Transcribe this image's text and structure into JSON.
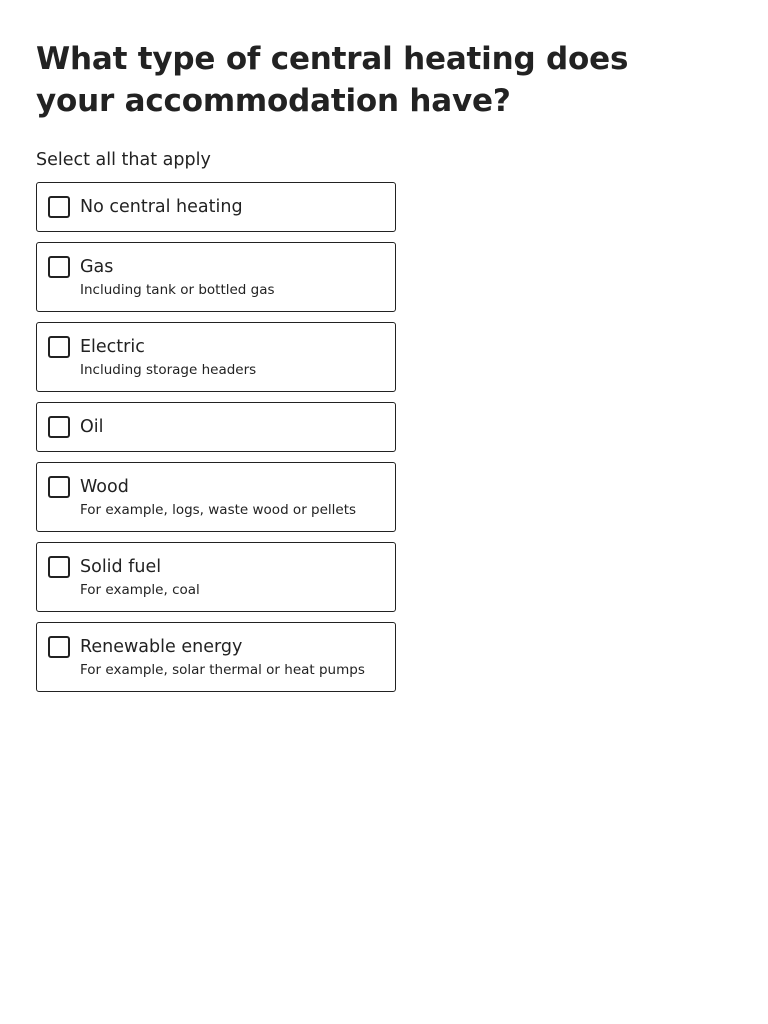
{
  "question": {
    "title": "What type of central heating does your accommodation have?",
    "hint": "Select all that apply"
  },
  "options": [
    {
      "label": "No central heating",
      "description": "",
      "checked": false
    },
    {
      "label": "Gas",
      "description": "Including tank or bottled gas",
      "checked": false
    },
    {
      "label": "Electric",
      "description": "Including storage headers",
      "checked": false
    },
    {
      "label": "Oil",
      "description": "",
      "checked": false
    },
    {
      "label": "Wood",
      "description": "For example, logs, waste wood or pellets",
      "checked": false
    },
    {
      "label": "Solid fuel",
      "description": "For example, coal",
      "checked": false
    },
    {
      "label": "Renewable energy",
      "description": "For example, solar thermal or heat pumps",
      "checked": false
    }
  ],
  "colors": {
    "text": "#222222",
    "border": "#222222",
    "background": "#ffffff"
  }
}
